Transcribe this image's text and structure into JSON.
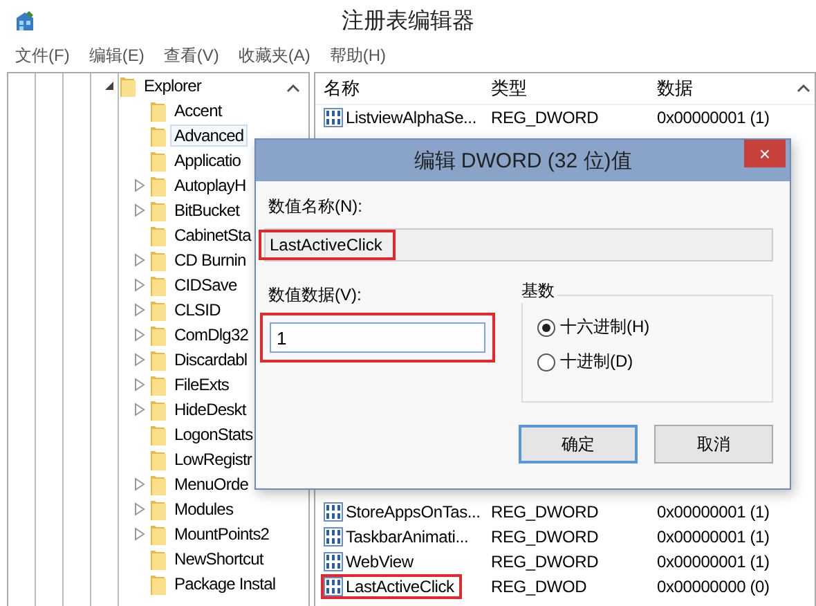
{
  "window": {
    "title": "注册表编辑器"
  },
  "menu": [
    "文件(F)",
    "编辑(E)",
    "查看(V)",
    "收藏夹(A)",
    "帮助(H)"
  ],
  "tree": {
    "items": [
      {
        "label": "Explorer",
        "kind": "branch",
        "expanded": true,
        "selected": false,
        "children": [
          {
            "label": "Accent",
            "kind": "leaf",
            "selected": false
          },
          {
            "label": "Advanced",
            "kind": "leaf",
            "selected": true
          },
          {
            "label": "Applicatio",
            "kind": "leaf",
            "selected": false
          },
          {
            "label": "AutoplayH",
            "kind": "branch",
            "expanded": false,
            "selected": false
          },
          {
            "label": "BitBucket",
            "kind": "branch",
            "expanded": false,
            "selected": false
          },
          {
            "label": "CabinetSta",
            "kind": "leaf",
            "selected": false
          },
          {
            "label": "CD Burnin",
            "kind": "branch",
            "expanded": false,
            "selected": false
          },
          {
            "label": "CIDSave",
            "kind": "branch",
            "expanded": false,
            "selected": false
          },
          {
            "label": "CLSID",
            "kind": "branch",
            "expanded": false,
            "selected": false
          },
          {
            "label": "ComDlg32",
            "kind": "branch",
            "expanded": false,
            "selected": false
          },
          {
            "label": "Discardabl",
            "kind": "branch",
            "expanded": false,
            "selected": false
          },
          {
            "label": "FileExts",
            "kind": "branch",
            "expanded": false,
            "selected": false
          },
          {
            "label": "HideDeskt",
            "kind": "branch",
            "expanded": false,
            "selected": false
          },
          {
            "label": "LogonStats",
            "kind": "leaf",
            "selected": false
          },
          {
            "label": "LowRegistr",
            "kind": "leaf",
            "selected": false
          },
          {
            "label": "MenuOrde",
            "kind": "branch",
            "expanded": false,
            "selected": false
          },
          {
            "label": "Modules",
            "kind": "branch",
            "expanded": false,
            "selected": false
          },
          {
            "label": "MountPoints2",
            "kind": "branch",
            "expanded": false,
            "selected": false
          },
          {
            "label": "NewShortcut",
            "kind": "leaf",
            "selected": false
          },
          {
            "label": "Package Instal",
            "kind": "leaf",
            "selected": false
          }
        ]
      }
    ]
  },
  "list": {
    "columns": [
      "名称",
      "类型",
      "数据"
    ],
    "rows_top": [
      {
        "name": "ListviewAlphaSe...",
        "type": "REG_DWORD",
        "data": "0x00000001 (1)",
        "highlighted": false
      }
    ],
    "rows_bottom": [
      {
        "name": "StoreAppsOnTas...",
        "type": "REG_DWORD",
        "data": "0x00000001 (1)",
        "highlighted": false
      },
      {
        "name": "TaskbarAnimati...",
        "type": "REG_DWORD",
        "data": "0x00000001 (1)",
        "highlighted": false
      },
      {
        "name": "WebView",
        "type": "REG_DWORD",
        "data": "0x00000001 (1)",
        "highlighted": false
      },
      {
        "name": "LastActiveClick",
        "type": "REG_DWOD",
        "data": "0x00000000 (0)",
        "highlighted": true
      }
    ]
  },
  "dialog": {
    "title": "编辑 DWORD (32 位)值",
    "close": "×",
    "name_label": "数值名称(N):",
    "name_value": "LastActiveClick",
    "name_highlighted": true,
    "data_label": "数值数据(V):",
    "data_value": "1",
    "data_highlighted": true,
    "base_label": "基数",
    "radios": [
      {
        "label": "十六进制(H)",
        "selected": true
      },
      {
        "label": "十进制(D)",
        "selected": false
      }
    ],
    "buttons": [
      {
        "label": "确定",
        "focused": true
      },
      {
        "label": "取消",
        "focused": false
      }
    ]
  }
}
